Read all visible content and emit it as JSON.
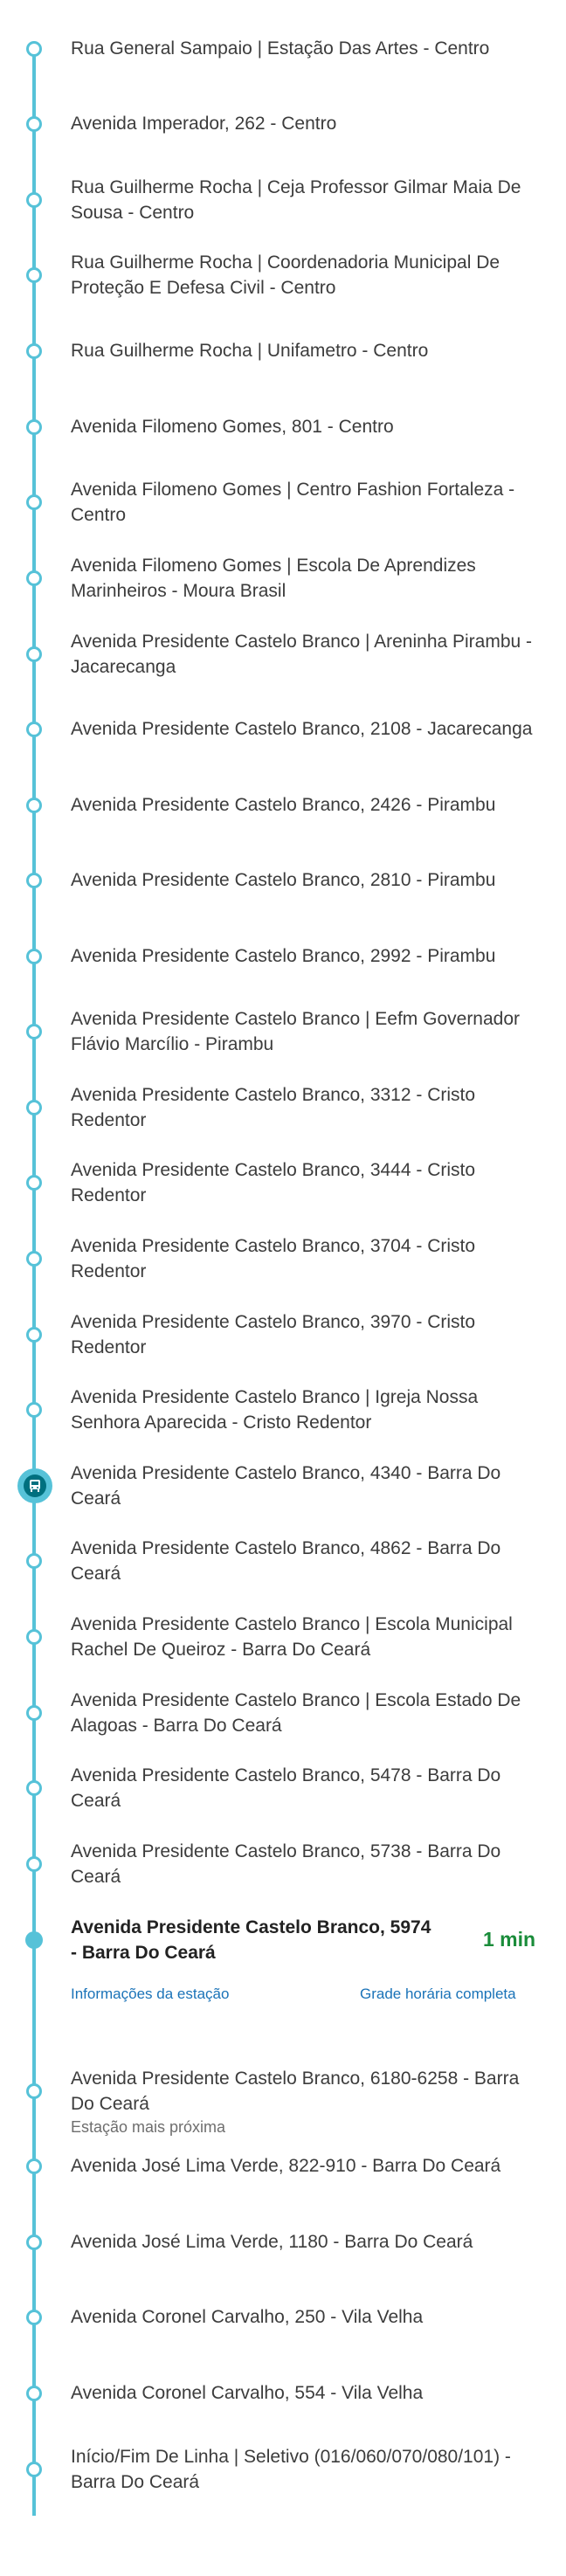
{
  "stops": [
    {
      "name": "Rua General Sampaio | Estação Das Artes - Centro"
    },
    {
      "name": "Avenida Imperador, 262 - Centro"
    },
    {
      "name": "Rua Guilherme Rocha | Ceja Professor Gilmar Maia De Sousa - Centro"
    },
    {
      "name": "Rua Guilherme Rocha | Coordenadoria Municipal De Proteção E Defesa Civil - Centro"
    },
    {
      "name": "Rua Guilherme Rocha | Unifametro - Centro"
    },
    {
      "name": "Avenida Filomeno Gomes, 801 - Centro"
    },
    {
      "name": "Avenida Filomeno Gomes | Centro Fashion Fortaleza - Centro"
    },
    {
      "name": "Avenida Filomeno Gomes | Escola De Aprendizes Marinheiros - Moura Brasil"
    },
    {
      "name": "Avenida Presidente Castelo Branco | Areninha Pirambu - Jacarecanga"
    },
    {
      "name": "Avenida Presidente Castelo Branco, 2108 - Jacarecanga"
    },
    {
      "name": "Avenida Presidente Castelo Branco, 2426 - Pirambu"
    },
    {
      "name": "Avenida Presidente Castelo Branco, 2810 - Pirambu"
    },
    {
      "name": "Avenida Presidente Castelo Branco, 2992 - Pirambu"
    },
    {
      "name": "Avenida Presidente Castelo Branco | Eefm Governador Flávio Marcílio - Pirambu"
    },
    {
      "name": "Avenida Presidente Castelo Branco, 3312 - Cristo Redentor"
    },
    {
      "name": "Avenida Presidente Castelo Branco, 3444 - Cristo Redentor"
    },
    {
      "name": "Avenida Presidente Castelo Branco, 3704 - Cristo Redentor"
    },
    {
      "name": "Avenida Presidente Castelo Branco, 3970 - Cristo Redentor"
    },
    {
      "name": "Avenida Presidente Castelo Branco | Igreja Nossa Senhora Aparecida - Cristo Redentor"
    },
    {
      "name": "Avenida Presidente Castelo Branco, 4340 - Barra Do Ceará",
      "bus_here": true
    },
    {
      "name": "Avenida Presidente Castelo Branco, 4862 - Barra Do Ceará"
    },
    {
      "name": "Avenida Presidente Castelo Branco | Escola Municipal Rachel De Queiroz - Barra Do Ceará"
    },
    {
      "name": "Avenida Presidente Castelo Branco | Escola Estado De Alagoas - Barra Do Ceará"
    },
    {
      "name": "Avenida Presidente Castelo Branco, 5478 - Barra Do Ceará"
    },
    {
      "name": "Avenida Presidente Castelo Branco, 5738 - Barra Do Ceará"
    },
    {
      "name": "Avenida Presidente Castelo Branco, 5974 - Barra Do Ceará",
      "current": true,
      "eta": "1 min"
    },
    {
      "name": "Avenida Presidente Castelo Branco, 6180-6258 - Barra Do Ceará",
      "subtitle": "Estação mais próxima"
    },
    {
      "name": "Avenida José Lima Verde, 822-910 - Barra Do Ceará"
    },
    {
      "name": "Avenida José Lima Verde, 1180 - Barra Do Ceará"
    },
    {
      "name": "Avenida Coronel Carvalho, 250 - Vila Velha"
    },
    {
      "name": "Avenida Coronel Carvalho, 554 - Vila Velha"
    },
    {
      "name": "Início/Fim De Linha | Seletivo (016/060/070/080/101) - Barra Do Ceará"
    }
  ],
  "station_info_link": "Informações da estação",
  "timetable_link": "Grade horária completa",
  "icons": {
    "bus": "bus-icon"
  },
  "colors": {
    "line": "#56c2d8",
    "eta": "#1a8c3a",
    "link": "#1a73b8",
    "bus_dark": "#00707f"
  }
}
